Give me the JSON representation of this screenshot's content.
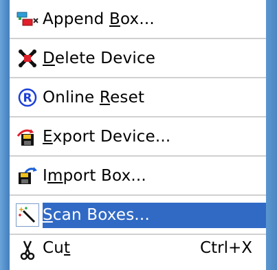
{
  "menu": {
    "items": [
      {
        "label_pre": "Append ",
        "label_key": "B",
        "label_post": "ox...",
        "icon": "append-box-icon"
      },
      {
        "label_pre": "",
        "label_key": "D",
        "label_post": "elete Device",
        "icon": "delete-device-icon"
      },
      {
        "label_pre": "Online ",
        "label_key": "R",
        "label_post": "eset",
        "icon": "online-reset-icon"
      },
      {
        "label_pre": "",
        "label_key": "E",
        "label_post": "xport Device...",
        "icon": "export-device-icon"
      },
      {
        "label_pre": "I",
        "label_key": "m",
        "label_post": "port Box...",
        "icon": "import-box-icon"
      },
      {
        "label_pre": "",
        "label_key": "S",
        "label_post": "can Boxes...",
        "icon": "scan-boxes-icon",
        "selected": true
      },
      {
        "label_pre": "Cu",
        "label_key": "t",
        "label_post": "",
        "icon": "cut-icon",
        "shortcut": "Ctrl+X"
      }
    ],
    "colors": {
      "highlight": "#316ac5",
      "separator": "#d0d0d0"
    }
  }
}
